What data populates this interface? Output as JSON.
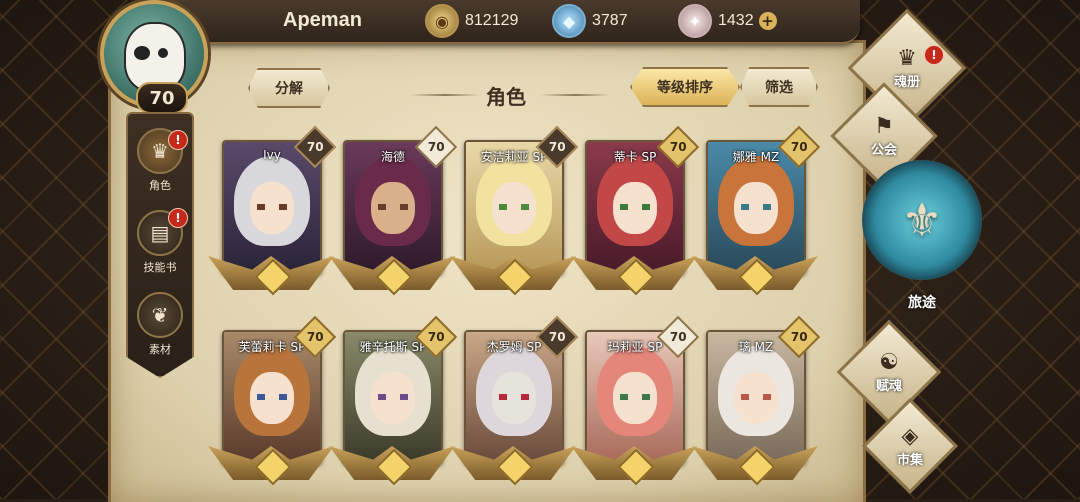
{
  "player": {
    "name": "Apeman",
    "level": "70"
  },
  "resources": [
    {
      "name": "gold",
      "value": "812129",
      "icon": "coin-icon"
    },
    {
      "name": "gem",
      "value": "3787",
      "icon": "gem-icon"
    },
    {
      "name": "crystal",
      "value": "1432",
      "icon": "crystal-icon"
    }
  ],
  "toolbar": {
    "decompose_label": "分解",
    "title": "角色",
    "sort_label": "等级排序",
    "filter_label": "筛选"
  },
  "side_tabs": [
    {
      "label": "角色",
      "icon": "character-icon",
      "alert": "!"
    },
    {
      "label": "技能书",
      "icon": "skillbook-icon",
      "alert": "!"
    },
    {
      "label": "素材",
      "icon": "material-icon",
      "alert": ""
    }
  ],
  "cards": [
    {
      "name": "Ivy",
      "level": "70",
      "badge": "dark",
      "hair": "#d8d8dc"
    },
    {
      "name": "海德",
      "level": "70",
      "badge": "light",
      "hair": "#6a2a4a"
    },
    {
      "name": "安洁莉亚 SP",
      "level": "70",
      "badge": "dark",
      "hair": "#f2e2a0"
    },
    {
      "name": "蒂卡 SP",
      "level": "70",
      "badge": "gold",
      "hair": "#c24848"
    },
    {
      "name": "娜雅 MZ",
      "level": "70",
      "badge": "gold",
      "hair": "#c8743a"
    },
    {
      "name": "芙蕾莉卡 SP",
      "level": "70",
      "badge": "gold",
      "hair": "#b8743a"
    },
    {
      "name": "雅辛托斯 SP",
      "level": "70",
      "badge": "gold",
      "hair": "#e6e0d0"
    },
    {
      "name": "杰罗姆 SP",
      "level": "70",
      "badge": "dark",
      "hair": "#ddd6da"
    },
    {
      "name": "玛莉亚 SP",
      "level": "70",
      "badge": "light",
      "hair": "#e4867a"
    },
    {
      "name": "璃 MZ",
      "level": "70",
      "badge": "gold",
      "hair": "#ece6e0"
    }
  ],
  "right_nav": [
    {
      "label": "魂册",
      "icon": "soulbook-icon",
      "alert": "!"
    },
    {
      "label": "公会",
      "icon": "guild-icon",
      "alert": ""
    },
    {
      "label": "旅途",
      "icon": "journey-icon",
      "alert": ""
    },
    {
      "label": "赋魂",
      "icon": "imbue-icon",
      "alert": ""
    },
    {
      "label": "市集",
      "icon": "market-icon",
      "alert": ""
    }
  ]
}
